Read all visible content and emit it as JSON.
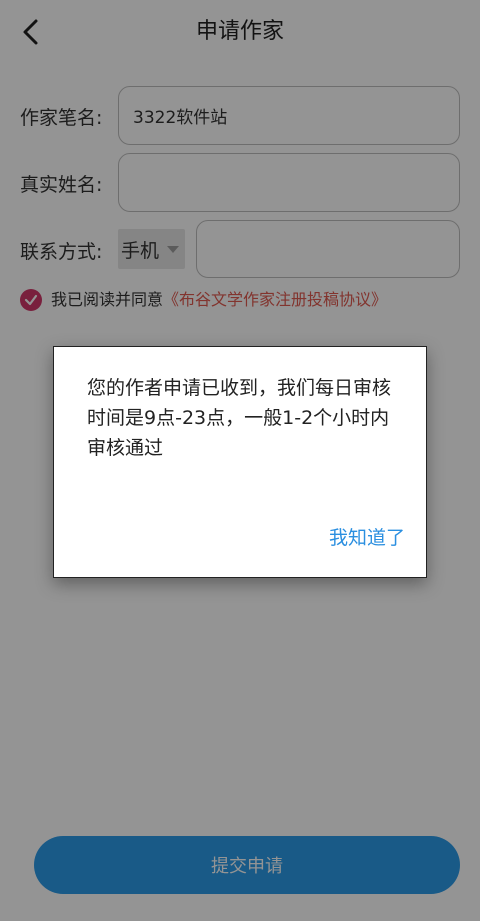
{
  "header": {
    "title": "申请作家",
    "back_icon": "chevron-left-icon"
  },
  "form": {
    "pen_name_label": "作家笔名:",
    "pen_name_value": "3322软件站",
    "real_name_label": "真实姓名:",
    "real_name_value": "",
    "contact_label": "联系方式:",
    "contact_type_selected": "手机",
    "contact_value": ""
  },
  "agreement": {
    "checked": true,
    "text": "我已阅读并同意",
    "link_text": "《布谷文学作家注册投稿协议》"
  },
  "submit": {
    "label": "提交申请"
  },
  "dialog": {
    "message": "您的作者申请已收到，我们每日审核时间是9点-23点，一般1-2个小时内审核通过",
    "button_label": "我知道了"
  },
  "colors": {
    "accent": "#2b9be8",
    "check": "#d0386a",
    "link": "#e05a50",
    "dialog_button": "#2b8fe0"
  }
}
